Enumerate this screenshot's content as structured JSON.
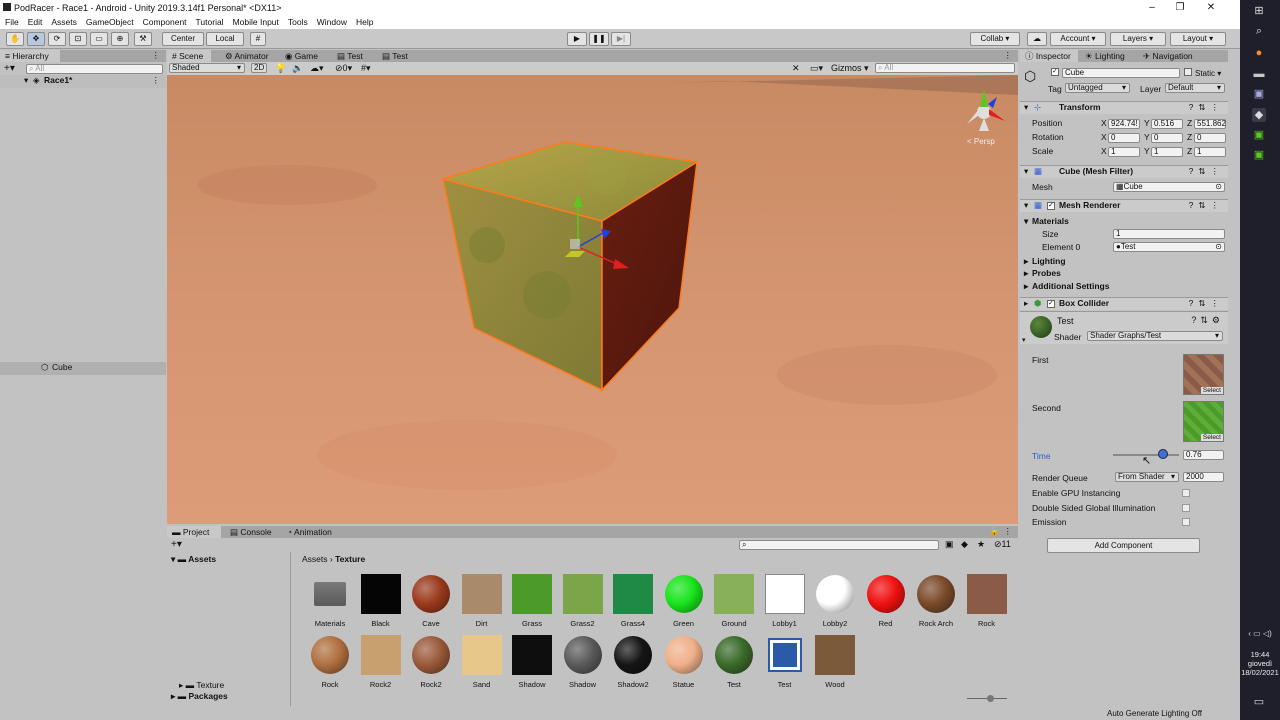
{
  "window": {
    "title": "PodRacer - Race1 - Android - Unity 2019.3.14f1 Personal* <DX11>",
    "min": "–",
    "max": "❐",
    "close": "✕"
  },
  "menu": [
    "File",
    "Edit",
    "Assets",
    "GameObject",
    "Component",
    "Tutorial",
    "Mobile Input",
    "Tools",
    "Window",
    "Help"
  ],
  "toolbar": {
    "center": "Center",
    "local": "Local",
    "collab": "Collab ▾",
    "account": "Account ▾",
    "layers": "Layers ▾",
    "layout": "Layout ▾"
  },
  "hierarchy": {
    "tab": "Hierarchy",
    "search_placeholder": "All",
    "scene": "Race1*",
    "selected": "Cube"
  },
  "scene_tabs": [
    "Scene",
    "Animator",
    "Game",
    "Test",
    "Test"
  ],
  "scene_bar": {
    "shading": "Shaded",
    "mode2d": "2D",
    "fx": "0",
    "gizmos": "Gizmos ▾",
    "search_placeholder": "All",
    "persp": "< Persp"
  },
  "inspector": {
    "tabs": [
      "Inspector",
      "Lighting",
      "Navigation"
    ],
    "object_name": "Cube",
    "static": "Static ▾",
    "tag_label": "Tag",
    "tag": "Untagged",
    "layer_label": "Layer",
    "layer": "Default",
    "transform": {
      "title": "Transform",
      "position_label": "Position",
      "rotation_label": "Rotation",
      "scale_label": "Scale",
      "position": [
        "924.74!",
        "0.516",
        "551.862"
      ],
      "rotation": [
        "0",
        "0",
        "0"
      ],
      "scale": [
        "1",
        "1",
        "1"
      ]
    },
    "mesh_filter": {
      "title": "Cube (Mesh Filter)",
      "mesh_label": "Mesh",
      "mesh": "Cube"
    },
    "mesh_renderer": {
      "title": "Mesh Renderer",
      "materials": "Materials",
      "size_label": "Size",
      "size": "1",
      "element_label": "Element 0",
      "element": "Test",
      "lighting": "Lighting",
      "probes": "Probes",
      "additional": "Additional Settings"
    },
    "box_collider": {
      "title": "Box Collider"
    },
    "material": {
      "name": "Test",
      "shader_label": "Shader",
      "shader": "Shader Graphs/Test",
      "first": "First",
      "second": "Second",
      "select": "Select",
      "time_label": "Time",
      "time_value": "0.76",
      "time_fraction": 0.76,
      "render_queue_label": "Render Queue",
      "render_queue_mode": "From Shader",
      "render_queue": "2000",
      "gpu_instancing": "Enable GPU Instancing",
      "double_sided": "Double Sided Global Illumination",
      "emission": "Emission"
    },
    "add_component": "Add Component"
  },
  "project": {
    "tabs": [
      "Project",
      "Console",
      "Animation"
    ],
    "assets_root": "Assets",
    "tree": [
      "Texture",
      "Packages"
    ],
    "breadcrumb": [
      "Assets",
      "Texture"
    ],
    "count": "11",
    "assets_row1": [
      {
        "name": "Materials",
        "kind": "folder"
      },
      {
        "name": "Black",
        "kind": "tex",
        "color": "#050505"
      },
      {
        "name": "Cave",
        "kind": "sphere",
        "color": "#9a3a1c"
      },
      {
        "name": "Dirt",
        "kind": "tex",
        "color": "#a98a6a"
      },
      {
        "name": "Grass",
        "kind": "tex",
        "color": "#4c9a2a"
      },
      {
        "name": "Grass2",
        "kind": "tex",
        "color": "#7aa548"
      },
      {
        "name": "Grass4",
        "kind": "tex",
        "color": "#1f8a46"
      },
      {
        "name": "Green",
        "kind": "sphere",
        "color": "#19e41c"
      },
      {
        "name": "Ground",
        "kind": "tex",
        "color": "#88b05a"
      },
      {
        "name": "Lobby1",
        "kind": "tex",
        "color": "#ffffff"
      },
      {
        "name": "Lobby2",
        "kind": "sphere",
        "color": "#ffffff"
      },
      {
        "name": "Red",
        "kind": "sphere",
        "color": "#f01010"
      },
      {
        "name": "Rock Arch",
        "kind": "sphere",
        "color": "#7a4a2a"
      },
      {
        "name": "Rock",
        "kind": "tex",
        "color": "#8a5c48"
      }
    ],
    "assets_row2": [
      {
        "name": "Rock",
        "kind": "sphere",
        "color": "#b07040"
      },
      {
        "name": "Rock2",
        "kind": "tex",
        "color": "#c8a070"
      },
      {
        "name": "Rock2",
        "kind": "sphere",
        "color": "#9a5a3a"
      },
      {
        "name": "Sand",
        "kind": "tex",
        "color": "#e8c88a"
      },
      {
        "name": "Shadow",
        "kind": "tex",
        "color": "#0e0e0e"
      },
      {
        "name": "Shadow",
        "kind": "sphere",
        "color": "#5a5a5a"
      },
      {
        "name": "Shadow2",
        "kind": "sphere",
        "color": "#151515"
      },
      {
        "name": "Statue",
        "kind": "sphere",
        "color": "#f0b08a"
      },
      {
        "name": "Test",
        "kind": "sphere",
        "color": "#3a6a2a"
      },
      {
        "name": "Test",
        "kind": "graph",
        "color": "#2a5aa8"
      },
      {
        "name": "Wood",
        "kind": "tex",
        "color": "#7a5a3a"
      }
    ]
  },
  "status": "Auto Generate Lighting Off",
  "taskbar": {
    "time": "19:44",
    "day": "giovedì",
    "date": "18/02/2021"
  },
  "colors": {
    "accent": "#3a72d8",
    "selection_outline": "#ff7a1a",
    "ground": "#d0906a"
  }
}
